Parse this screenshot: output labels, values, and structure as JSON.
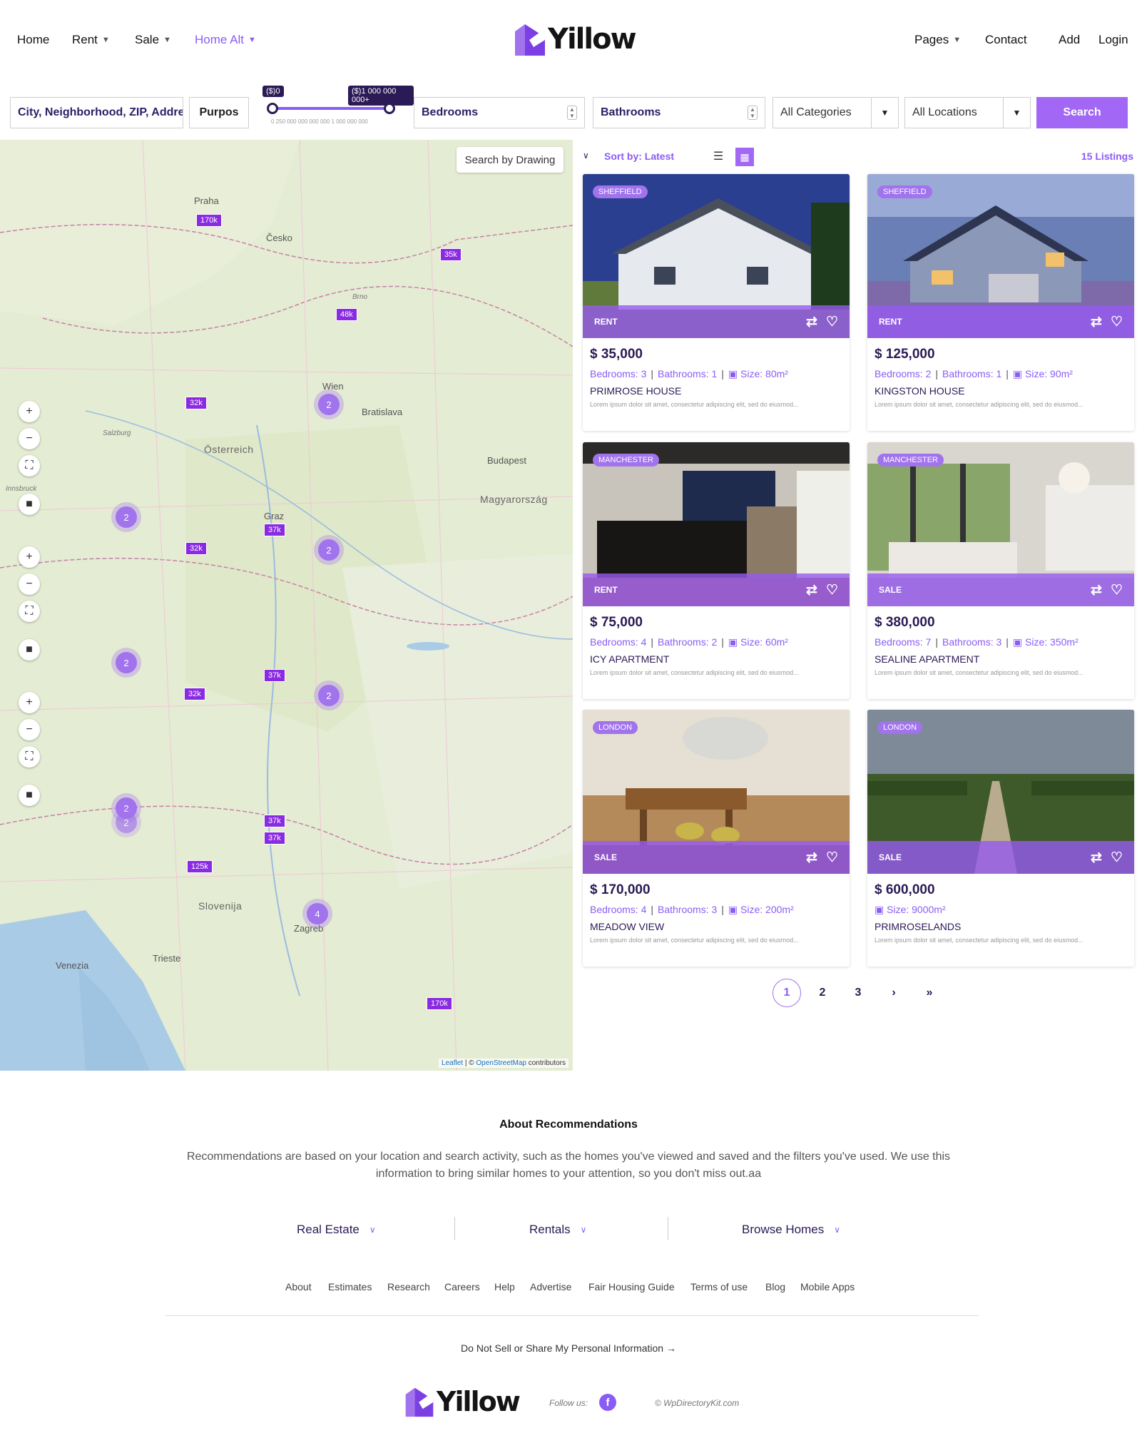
{
  "header": {
    "nav_left": [
      {
        "label": "Home",
        "chevron": false
      },
      {
        "label": "Rent",
        "chevron": true
      },
      {
        "label": "Sale",
        "chevron": true
      },
      {
        "label": "Home Alt",
        "chevron": true,
        "active": true
      }
    ],
    "logo_text": "Yillow",
    "nav_right": [
      {
        "label": "Pages",
        "chevron": true
      },
      {
        "label": "Contact"
      },
      {
        "label": "Add"
      },
      {
        "label": "Login"
      }
    ]
  },
  "search": {
    "location_placeholder": "City, Neighborhood, ZIP, Address",
    "purpose_label": "Purpos",
    "price_min_tag": "($)0",
    "price_max_tag": "($)1 000 000 000+",
    "price_scale": "0   250 000 000 000 000   1 000 000 000",
    "bedrooms_label": "Bedrooms",
    "bathrooms_label": "Bathrooms",
    "categories_label": "All Categories",
    "locations_label": "All Locations",
    "search_button": "Search"
  },
  "map": {
    "draw_button": "Search by Drawing",
    "attribution_leaflet": "Leaflet",
    "attribution_sep": " | © ",
    "attribution_osm": "OpenStreetMap",
    "attribution_tail": " contributors",
    "markers": [
      "170k",
      "35k",
      "48k",
      "32k",
      "32k",
      "37k",
      "32k",
      "37k",
      "37k",
      "37k",
      "125k",
      "170k"
    ],
    "clusters": [
      "2",
      "2",
      "2",
      "2",
      "2",
      "2",
      "2",
      "4"
    ],
    "labels": [
      "Praha",
      "Česko",
      "Wien",
      "Bratislava",
      "Österreich",
      "Budapest",
      "Magyarország",
      "Slovenija",
      "Zagreb",
      "Graz",
      "Brno",
      "Venezia",
      "Trieste",
      "Salzburg",
      "Innsbruck"
    ],
    "zoom_in": "+",
    "zoom_out": "−"
  },
  "listings_toolbar": {
    "sort_label": "Sort by: Latest",
    "count": "15 Listings"
  },
  "listings": [
    {
      "city": "SHEFFIELD",
      "purpose": "RENT",
      "price": "$ 35,000",
      "bedrooms": "Bedrooms: 3",
      "bathrooms": "Bathrooms: 1",
      "size": "Size: 80m²",
      "name": "PRIMROSE HOUSE",
      "desc": "Lorem ipsum dolor sit amet, consectetur adipiscing elit, sed do eiusmod..."
    },
    {
      "city": "SHEFFIELD",
      "purpose": "RENT",
      "price": "$ 125,000",
      "bedrooms": "Bedrooms: 2",
      "bathrooms": "Bathrooms: 1",
      "size": "Size: 90m²",
      "name": "KINGSTON HOUSE",
      "desc": "Lorem ipsum dolor sit amet, consectetur adipiscing elit, sed do eiusmod..."
    },
    {
      "city": "MANCHESTER",
      "purpose": "RENT",
      "price": "$ 75,000",
      "bedrooms": "Bedrooms: 4",
      "bathrooms": "Bathrooms: 2",
      "size": "Size: 60m²",
      "name": "ICY APARTMENT",
      "desc": "Lorem ipsum dolor sit amet, consectetur adipiscing elit, sed do eiusmod..."
    },
    {
      "city": "MANCHESTER",
      "purpose": "SALE",
      "price": "$ 380,000",
      "bedrooms": "Bedrooms: 7",
      "bathrooms": "Bathrooms: 3",
      "size": "Size: 350m²",
      "name": "SEALINE APARTMENT",
      "desc": "Lorem ipsum dolor sit amet, consectetur adipiscing elit, sed do eiusmod..."
    },
    {
      "city": "LONDON",
      "purpose": "SALE",
      "price": "$ 170,000",
      "bedrooms": "Bedrooms: 4",
      "bathrooms": "Bathrooms: 3",
      "size": "Size: 200m²",
      "name": "MEADOW VIEW",
      "desc": "Lorem ipsum dolor sit amet, consectetur adipiscing elit, sed do eiusmod..."
    },
    {
      "city": "LONDON",
      "purpose": "SALE",
      "price": "$ 600,000",
      "bedrooms": "",
      "bathrooms": "",
      "size": "Size: 9000m²",
      "name": "PRIMROSELANDS",
      "desc": "Lorem ipsum dolor sit amet, consectetur adipiscing elit, sed do eiusmod..."
    }
  ],
  "pagination": [
    "1",
    "2",
    "3",
    "›",
    "»"
  ],
  "about": {
    "title": "About Recommendations",
    "text_line1": "Recommendations are based on your location and search activity, such as the homes you've viewed and saved and the filters you've used. We use this",
    "text_line2": "information to bring similar homes to your attention, so you don't miss out.aa"
  },
  "footer": {
    "categories": [
      "Real Estate",
      "Rentals",
      "Browse Homes"
    ],
    "links": [
      "About",
      "Estimates",
      "Research",
      "Careers",
      "Help",
      "Advertise",
      "Fair Housing Guide",
      "Terms of use",
      "Blog",
      "Mobile Apps"
    ],
    "privacy": "Do Not Sell or Share My Personal Information →",
    "follow": "Follow us:",
    "copyright": "© WpDirectoryKit.com"
  },
  "colors": {
    "accent": "#a267f5",
    "dark": "#2b1a55",
    "marker": "#8a2be2"
  }
}
